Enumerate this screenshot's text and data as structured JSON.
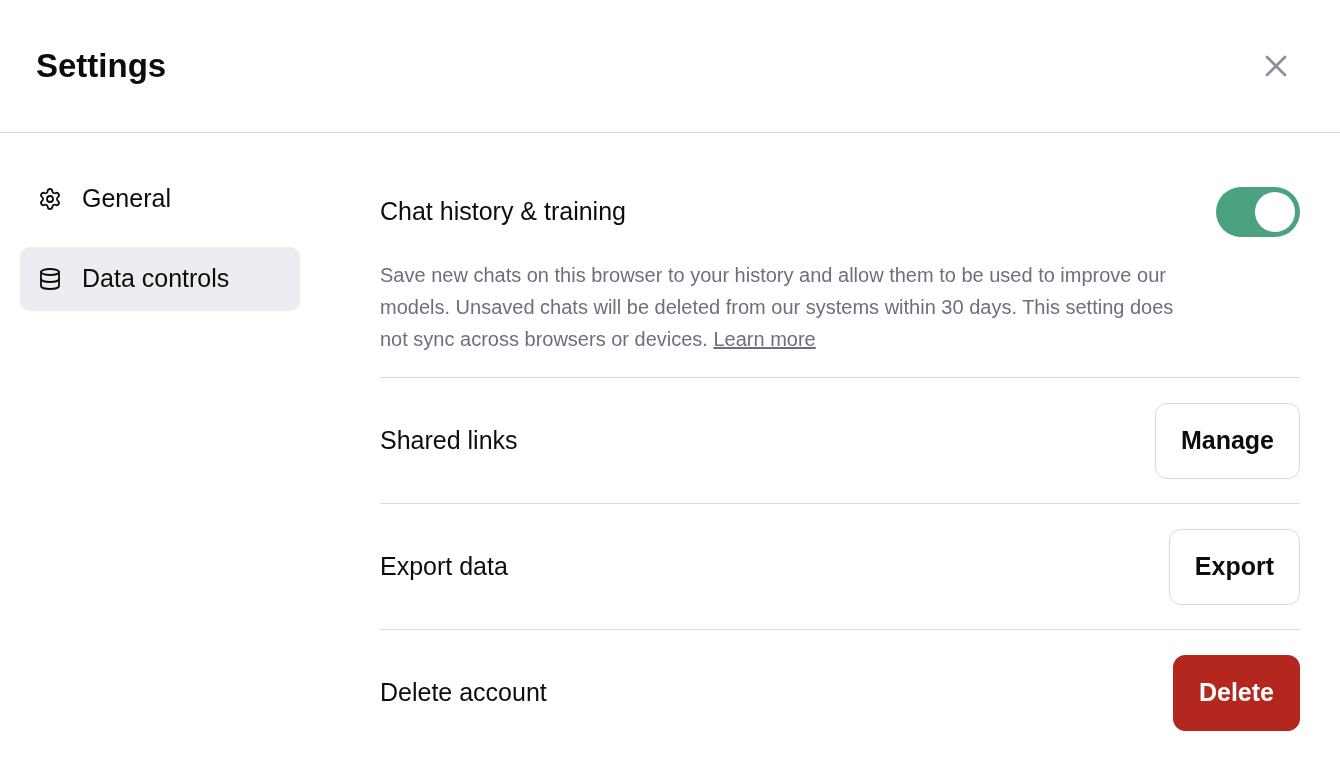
{
  "dialog": {
    "title": "Settings"
  },
  "sidebar": {
    "items": [
      {
        "label": "General",
        "selected": false
      },
      {
        "label": "Data controls",
        "selected": true
      }
    ]
  },
  "rows": [
    {
      "kind": "toggle",
      "label": "Chat history & training",
      "on": true,
      "description": {
        "text": "Save new chats on this browser to your history and allow them to be used to improve our models. Unsaved chats will be deleted from our systems within 30 days. This setting does not sync across browsers or devices.",
        "link": "Learn more"
      }
    },
    {
      "kind": "button",
      "label": "Shared links",
      "button": {
        "label": "Manage",
        "kind": "outline"
      }
    },
    {
      "kind": "button",
      "label": "Export data",
      "button": {
        "label": "Export",
        "kind": "outline"
      }
    },
    {
      "kind": "button",
      "label": "Delete account",
      "button": {
        "label": "Delete",
        "kind": "danger"
      }
    }
  ]
}
